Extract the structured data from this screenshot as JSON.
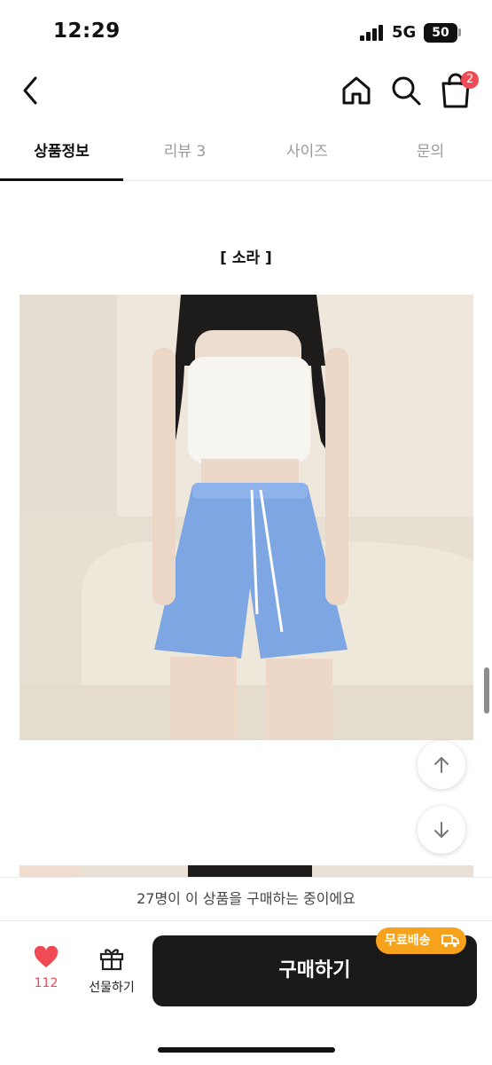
{
  "status_bar": {
    "time": "12:29",
    "network": "5G",
    "battery": "50"
  },
  "nav": {
    "cart_count": "2"
  },
  "tabs": [
    {
      "label": "상품정보"
    },
    {
      "label": "리뷰 3"
    },
    {
      "label": "사이즈"
    },
    {
      "label": "문의"
    }
  ],
  "content": {
    "color_title": "[ 소라 ]"
  },
  "bottom": {
    "notice": "27명이 이 상품을 구매하는 중이에요",
    "like_count": "112",
    "gift_label": "선물하기",
    "buy_label": "구매하기",
    "free_shipping": "무료배송"
  },
  "colors": {
    "accent": "#f04a55",
    "buy_button": "#1a1a1a",
    "free_shipping": "#f7a21b",
    "shorts": "#7ea6e3"
  }
}
